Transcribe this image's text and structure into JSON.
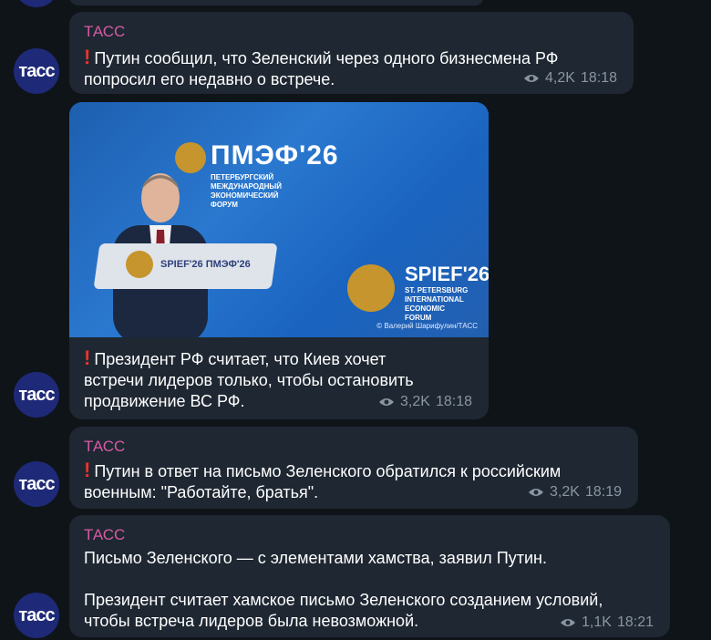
{
  "channel": {
    "sender": "ТАСС",
    "avatar_text": "тасс"
  },
  "messages": [
    {
      "sender": "ТАСС",
      "text_lines": [
        "Путин сообщил, что Зеленский через одного бизнесмена РФ",
        "попросил его недавно о встрече."
      ],
      "views": "4,2K",
      "time": "18:18",
      "important": true
    },
    {
      "photo": {
        "logo_ru": "ПМЭФ'26",
        "logo_ru_sub": [
          "ПЕТЕРБУРГСКИЙ",
          "МЕЖДУНАРОДНЫЙ",
          "ЭКОНОМИЧЕСКИЙ",
          "ФОРУМ"
        ],
        "logo_en": "SPIEF'26",
        "logo_en_sub": [
          "ST. PETERSBURG",
          "INTERNATIONAL",
          "ECONOMIC",
          "FORUM"
        ],
        "podium_label": "SPIEF'26  ПМЭФ'26",
        "credit": "© Валерий Шарифулин/ТАСС"
      },
      "text_lines": [
        "Президент РФ считает, что Киев хочет",
        "встречи лидеров только, чтобы остановить",
        "продвижение ВС РФ."
      ],
      "views": "3,2K",
      "time": "18:18",
      "important": true
    },
    {
      "sender": "ТАСС",
      "text_lines": [
        "Путин в ответ на письмо Зеленского обратился к российским",
        "военным: \"Работайте, братья\"."
      ],
      "views": "3,2K",
      "time": "18:19",
      "important": true
    },
    {
      "sender": "ТАСС",
      "text_lines": [
        "Письмо Зеленского — с элементами хамства, заявил Путин.",
        "",
        "Президент считает хамское письмо Зеленского созданием условий,",
        "чтобы встреча лидеров была невозможной."
      ],
      "views": "1,1K",
      "time": "18:21",
      "important": false
    }
  ],
  "colors": {
    "background": "#0f1419",
    "bubble": "#1e2732",
    "sender": "#d65aa3",
    "meta": "#8a96a3",
    "avatar": "#1e2a78",
    "exclamation": "#e8332e"
  }
}
